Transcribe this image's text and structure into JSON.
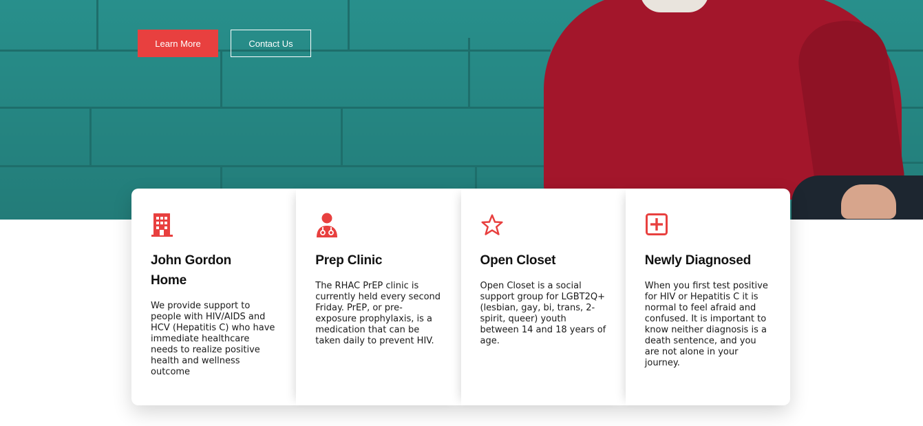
{
  "hero": {
    "buttons": {
      "learn_more": "Learn More",
      "contact_us": "Contact Us"
    }
  },
  "colors": {
    "accent": "#e8403f",
    "hero_wall": "#2a9793",
    "sweater": "#a3162b"
  },
  "cards": [
    {
      "icon": "hospital-building-icon",
      "title": "John Gordon Home",
      "text": "We provide support to people with HIV/AIDS and HCV (Hepatitis C) who have immediate healthcare needs to realize positive health and wellness outcome"
    },
    {
      "icon": "doctor-stethoscope-icon",
      "title": "Prep Clinic",
      "text": "The RHAC PrEP clinic is currently held every second Friday. PrEP, or pre-exposure prophylaxis, is a medication that can be taken daily to prevent HIV."
    },
    {
      "icon": "star-outline-icon",
      "title": "Open Closet",
      "text": "Open Closet is a social support group for LGBT2Q+ (lesbian, gay, bi, trans, 2-spirit, queer) youth between 14 and 18 years of age."
    },
    {
      "icon": "medical-plus-square-icon",
      "title": "Newly Diagnosed",
      "text": "When you first test positive for HIV or Hepatitis C it is normal to feel afraid and confused. It is important to know neither diagnosis is a death sentence, and you are not alone in your journey."
    }
  ]
}
